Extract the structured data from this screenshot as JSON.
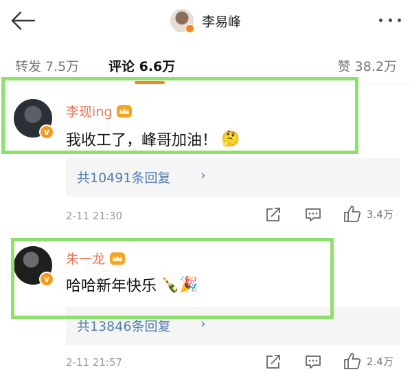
{
  "header": {
    "title": "李易峰",
    "back_icon": "back-arrow-icon",
    "more_icon": "more-dots-icon"
  },
  "tabs": {
    "repost_label": "转发 7.5万",
    "comment_label": "评论 6.6万",
    "like_label": "赞 38.2万",
    "active": "comment"
  },
  "comments": [
    {
      "author": "李现ing",
      "text": "我收工了，峰哥加油！",
      "emoji": "🤔",
      "replies_label": "共10491条回复",
      "time": "2-11 21:30",
      "likes": "3.4万"
    },
    {
      "author": "朱一龙",
      "text": "哈哈新年快乐",
      "emoji": "🍾🎉",
      "replies_label": "共13846条回复",
      "time": "2-11 21:57",
      "likes": "2.4万"
    }
  ],
  "colors": {
    "accent": "#f5861f",
    "username": "#eb7350",
    "link": "#507daf",
    "highlight": "#8ee06d"
  }
}
